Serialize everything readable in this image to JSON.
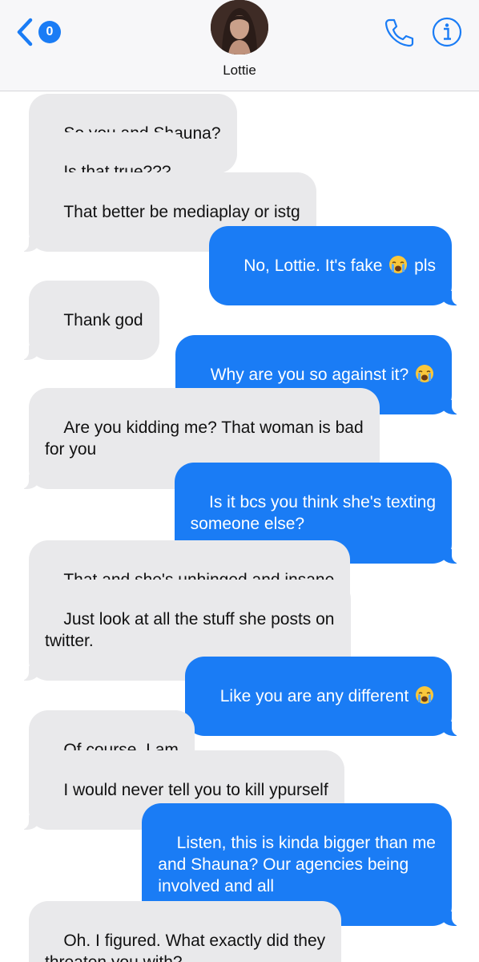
{
  "header": {
    "back_badge_count": "0",
    "contact_name": "Lottie",
    "icons": {
      "back": "chevron-left-icon",
      "call": "phone-icon",
      "info": "info-icon"
    },
    "accent_color": "#1a7cf5"
  },
  "messages": [
    {
      "direction": "incoming",
      "text": "So you and Shauna?"
    },
    {
      "direction": "incoming",
      "text": "Is that true???"
    },
    {
      "direction": "incoming",
      "text": "That better be mediaplay or istg"
    },
    {
      "direction": "outgoing",
      "text_before": "No, Lottie. It's fake ",
      "emoji": "loudly-crying-face",
      "text_after": " pls"
    },
    {
      "direction": "incoming",
      "text": "Thank god"
    },
    {
      "direction": "outgoing",
      "text_before": "Why are you so against it? ",
      "emoji": "loudly-crying-face"
    },
    {
      "direction": "incoming",
      "text": "Are you kidding me? That woman is bad\nfor you"
    },
    {
      "direction": "outgoing",
      "text": "Is it bcs you think she's texting\nsomeone else?"
    },
    {
      "direction": "incoming",
      "text": "That and she's unhinged and insane"
    },
    {
      "direction": "incoming",
      "text": "Just look at all the stuff she posts on\ntwitter."
    },
    {
      "direction": "outgoing",
      "text_before": "Like you are any different ",
      "emoji": "loudly-crying-face"
    },
    {
      "direction": "incoming",
      "text": "Of course. I am"
    },
    {
      "direction": "incoming",
      "text": "I would never tell you to kill ypurself"
    },
    {
      "direction": "outgoing",
      "text": "Listen, this is kinda bigger than me\nand Shauna? Our agencies being\ninvolved and all"
    },
    {
      "direction": "incoming",
      "text": "Oh. I figured. What exactly did they\nthreaten you with?"
    }
  ],
  "colors": {
    "incoming_bubble": "#e9e9eb",
    "outgoing_bubble": "#1a7cf5"
  }
}
